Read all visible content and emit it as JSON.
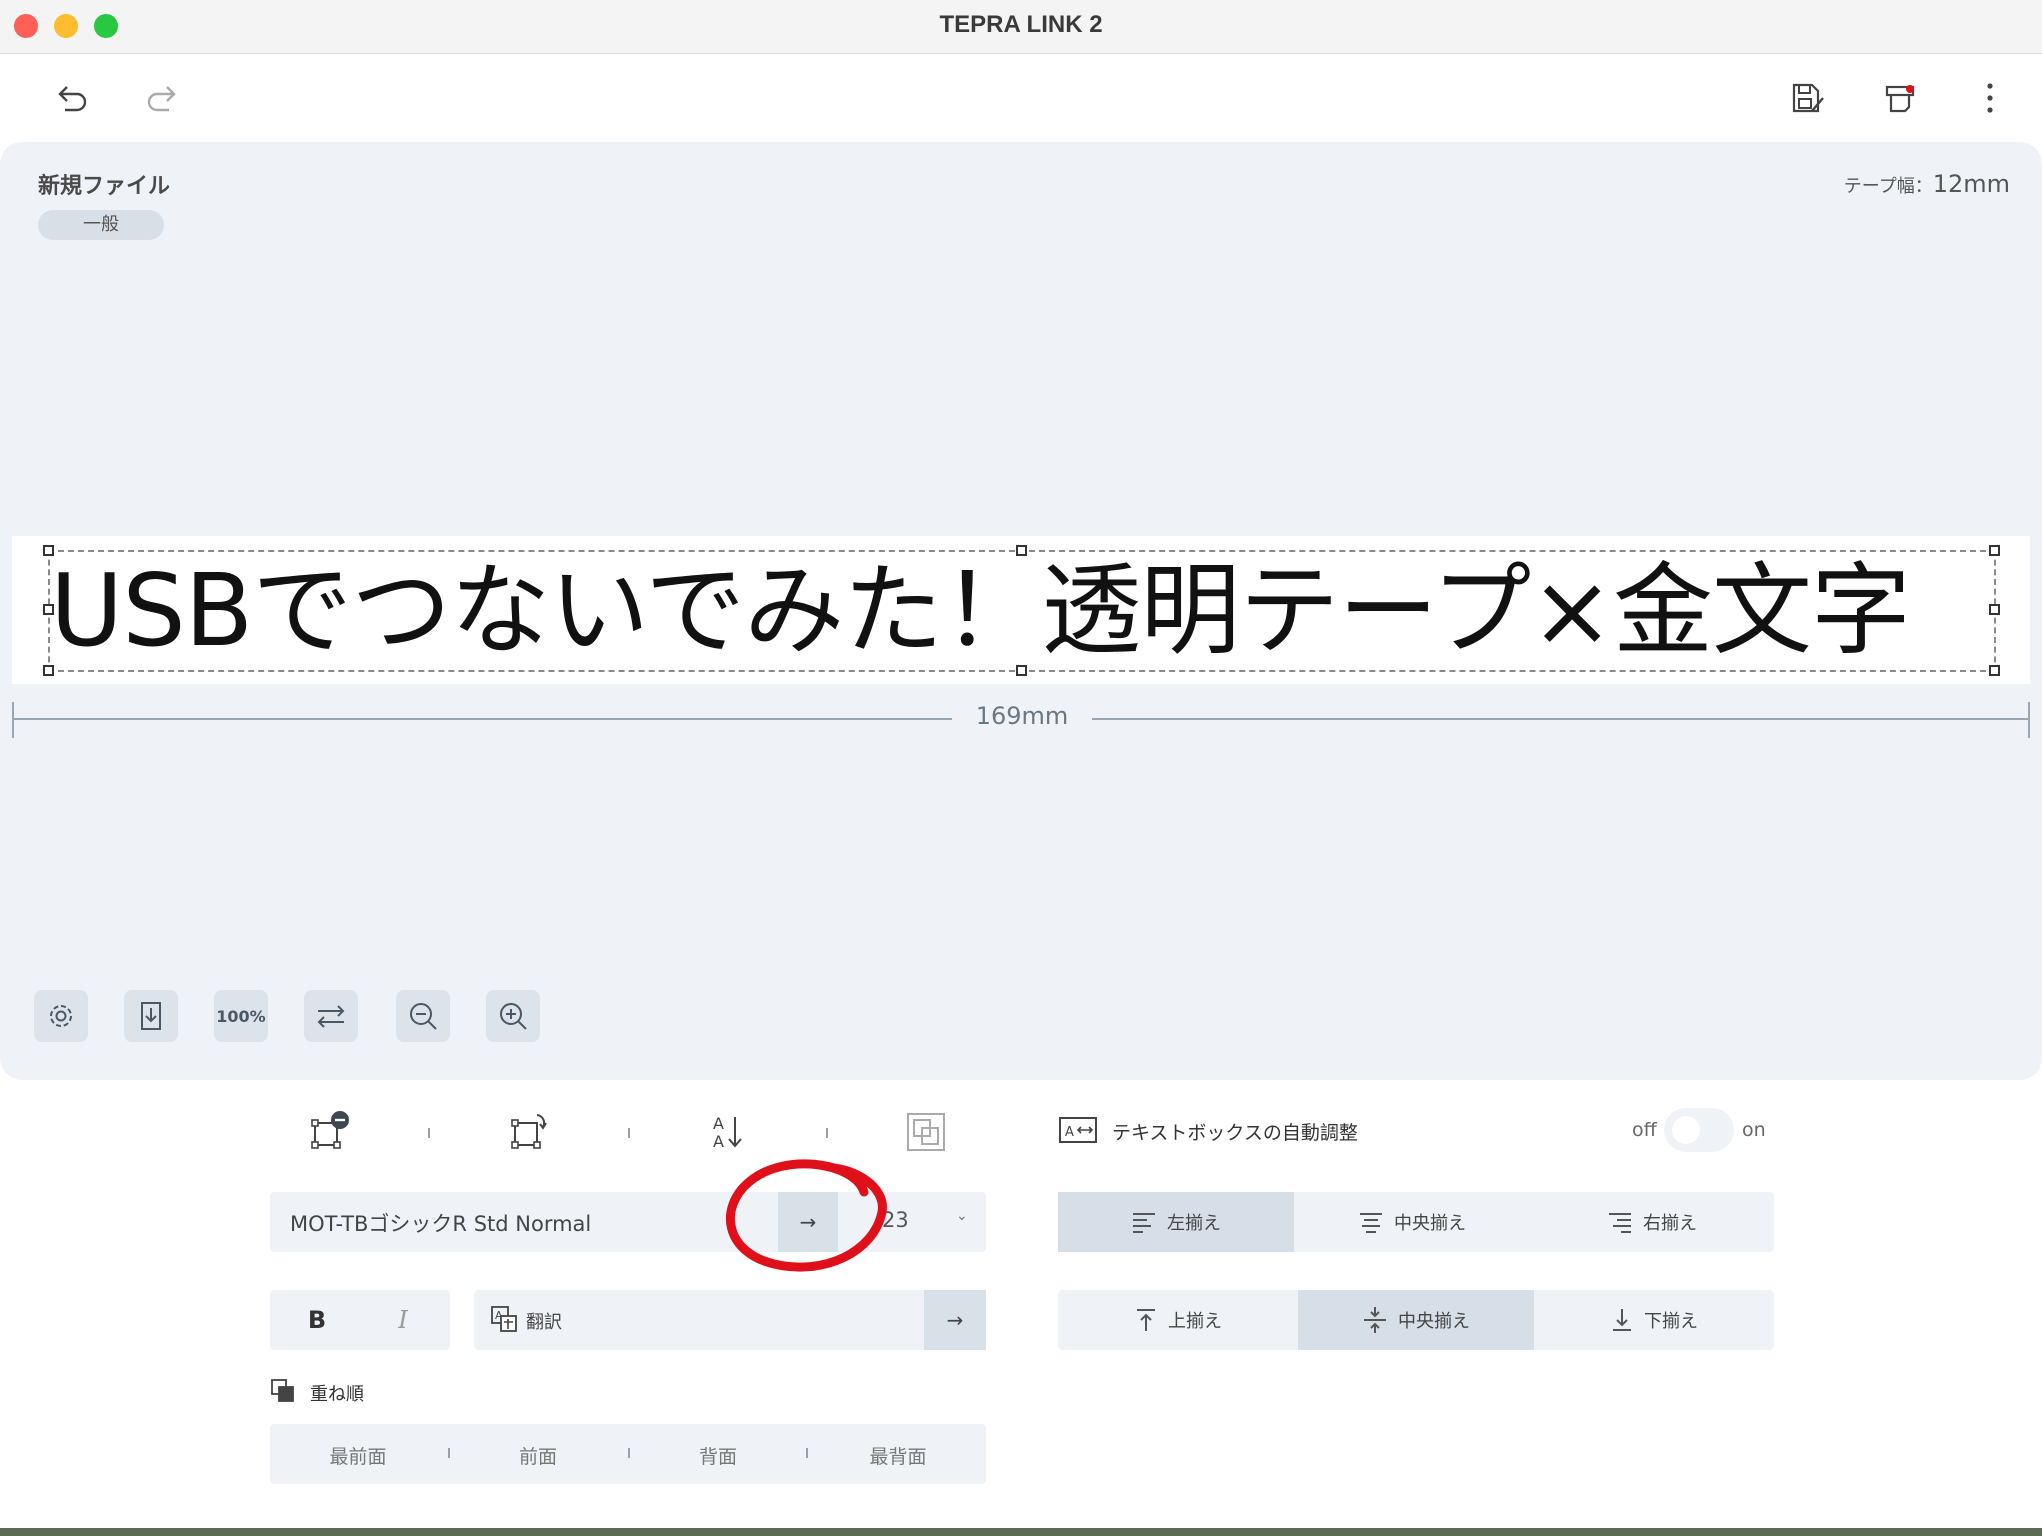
{
  "window": {
    "title": "TEPRA LINK 2"
  },
  "toolbar": {
    "undo": "undo-icon",
    "redo": "redo-icon",
    "save": "save-edit-icon",
    "print": "print-icon",
    "more": "more-vertical-icon"
  },
  "file": {
    "name": "新規ファイル",
    "category": "一般"
  },
  "tape": {
    "width_label": "テープ幅：",
    "width_value": "12mm"
  },
  "label": {
    "text": "USBでつないでみた！透明テープ×金文字",
    "length": "169mm"
  },
  "canvas_tools": {
    "zoom_level": "100%"
  },
  "font": {
    "name": "MOT-TBゴシックR Std Normal",
    "arrow": "→",
    "size": "23",
    "chevron": "⌄"
  },
  "style": {
    "bold": "B",
    "italic": "I"
  },
  "translate": {
    "label": "翻訳",
    "arrow": "→"
  },
  "order": {
    "title": "重ね順",
    "items": [
      "最前面",
      "前面",
      "背面",
      "最背面"
    ]
  },
  "autofit": {
    "label": "テキストボックスの自動調整",
    "off": "off",
    "on": "on",
    "enabled": false
  },
  "h_align": {
    "items": [
      "左揃え",
      "中央揃え",
      "右揃え"
    ],
    "active_index": 0
  },
  "v_align": {
    "items": [
      "上揃え",
      "中央揃え",
      "下揃え"
    ],
    "active_index": 1
  },
  "colors": {
    "canvas_bg": "#eff3f7",
    "active_segment": "#d6dee7",
    "annotation_red": "#e0101a"
  }
}
